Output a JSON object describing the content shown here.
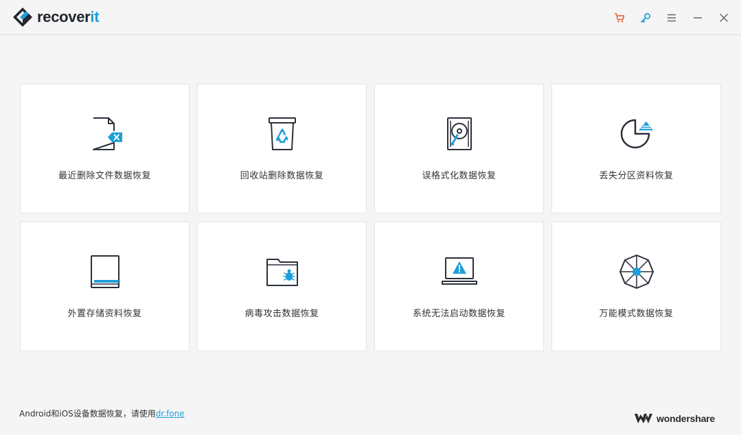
{
  "app": {
    "logo_main": "recover",
    "logo_accent": "it"
  },
  "window_controls": [
    {
      "name": "cart-icon",
      "color": "#e8572a"
    },
    {
      "name": "key-icon",
      "color": "#1d9fd9"
    },
    {
      "name": "menu-icon",
      "color": "#666666"
    },
    {
      "name": "minimize-icon",
      "color": "#666666"
    },
    {
      "name": "close-icon",
      "color": "#666666"
    }
  ],
  "modes": [
    {
      "label": "最近删除文件数据恢复",
      "icon": "deleted-file-icon"
    },
    {
      "label": "回收站删除数据恢复",
      "icon": "recycle-bin-icon"
    },
    {
      "label": "误格式化数据恢复",
      "icon": "formatted-disk-icon"
    },
    {
      "label": "丢失分区资料恢复",
      "icon": "lost-partition-icon"
    },
    {
      "label": "外置存储资料恢复",
      "icon": "external-device-icon"
    },
    {
      "label": "病毒攻击数据恢复",
      "icon": "virus-folder-icon"
    },
    {
      "label": "系统无法启动数据恢复",
      "icon": "crashed-computer-icon"
    },
    {
      "label": "万能模式数据恢复",
      "icon": "all-around-icon"
    }
  ],
  "footer": {
    "note": "Android和iOS设备数据恢复，请使用",
    "link": "dr.fone",
    "brand": "wondershare"
  },
  "colors": {
    "accent": "#1d9fd9",
    "icon_stroke": "#2a2f3a",
    "background": "#f5f5f5",
    "card": "#ffffff"
  }
}
